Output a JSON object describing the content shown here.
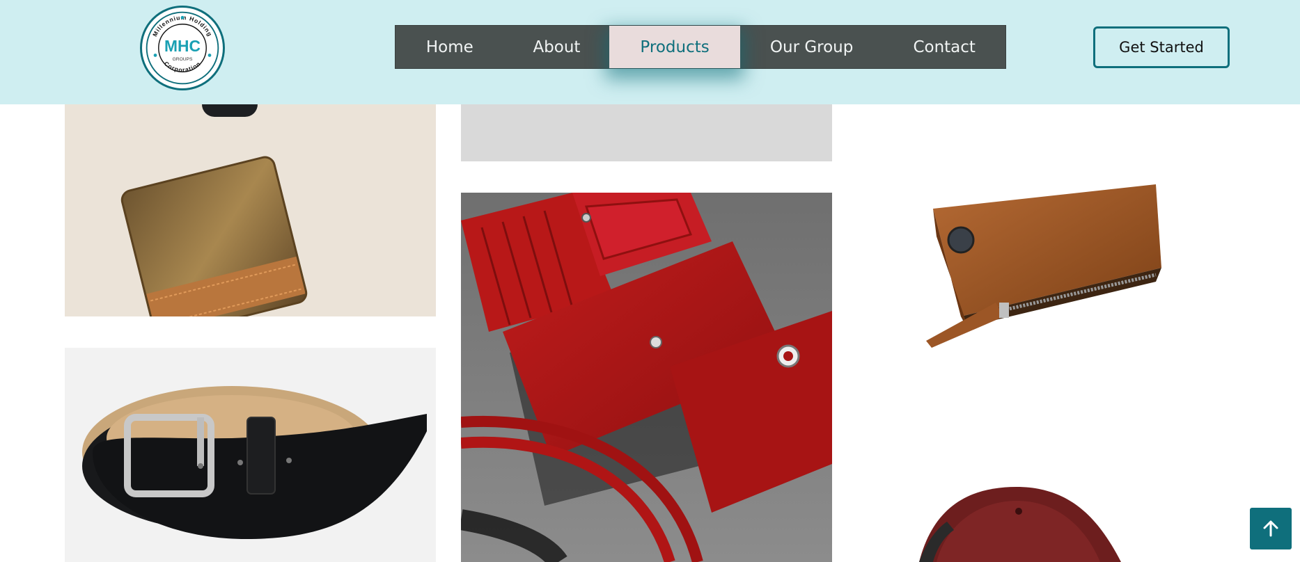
{
  "header": {
    "logo": {
      "ring_text_top": "Millennium Holding",
      "ring_text_bottom": "Corporation",
      "monogram": "MHC",
      "sub": "GROUPS"
    },
    "nav": [
      {
        "label": "Home",
        "active": false
      },
      {
        "label": "About",
        "active": false
      },
      {
        "label": "Products",
        "active": true
      },
      {
        "label": "Our Group",
        "active": false
      },
      {
        "label": "Contact",
        "active": false
      }
    ],
    "cta_label": "Get Started"
  },
  "gallery": {
    "items": [
      {
        "name": "gold-wallet",
        "icon": "bifold-wallet-image"
      },
      {
        "name": "gray-placeholder",
        "icon": "image-placeholder"
      },
      {
        "name": "red-wallet-set",
        "icon": "clutch-wallet-image"
      },
      {
        "name": "black-belt",
        "icon": "belt-image"
      },
      {
        "name": "brown-zip-wallet",
        "icon": "zip-wallet-image"
      },
      {
        "name": "maroon-belt",
        "icon": "belt-image"
      }
    ]
  },
  "back_to_top": {
    "icon": "arrow-up-icon"
  },
  "colors": {
    "header_bg": "#cfeef1",
    "nav_bg": "#4a5150",
    "nav_active_bg": "#e9dcdc",
    "accent": "#0f6f7c"
  }
}
